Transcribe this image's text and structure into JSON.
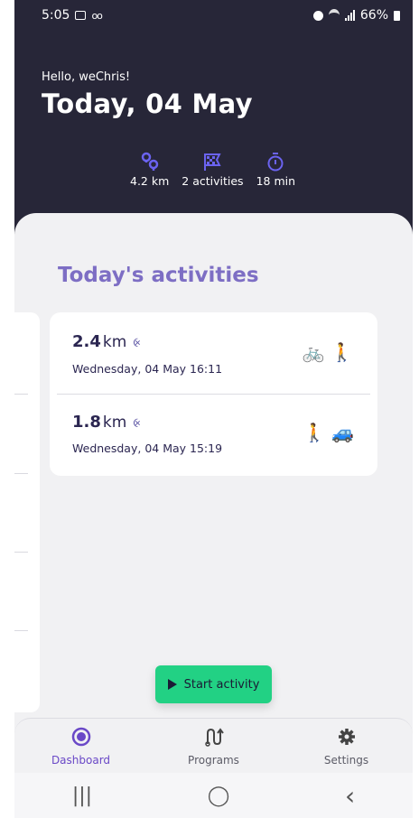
{
  "status_bar": {
    "time": "5:05",
    "battery": "66%"
  },
  "header": {
    "greeting": "Hello, weChris!",
    "title": "Today, 04 May",
    "stats": [
      {
        "icon": "location-pin-icon",
        "label": "4.2 km"
      },
      {
        "icon": "checkered-flag-icon",
        "label": "2 activities"
      },
      {
        "icon": "stopwatch-icon",
        "label": "18 min"
      }
    ]
  },
  "section_title": "Today's activities",
  "activities": [
    {
      "distance": "2.4",
      "unit": "km",
      "date": "Wednesday, 04 May 16:11",
      "modes": "🚲 🚶"
    },
    {
      "distance": "1.8",
      "unit": "km",
      "date": "Wednesday, 04 May 15:19",
      "modes": "🚶 🚙"
    }
  ],
  "start_button": "Start activity",
  "bottom_nav": [
    {
      "label": "Dashboard",
      "icon": "dashboard-icon",
      "active": true
    },
    {
      "label": "Programs",
      "icon": "route-icon",
      "active": false
    },
    {
      "label": "Settings",
      "icon": "gear-icon",
      "active": false
    }
  ],
  "system_nav": {
    "recents": "|||",
    "home": "◯",
    "back": "‹"
  },
  "colors": {
    "header_bg": "#272638",
    "accent": "#6a48c7",
    "title_purple": "#7d6ec4",
    "start_green": "#22d184"
  }
}
